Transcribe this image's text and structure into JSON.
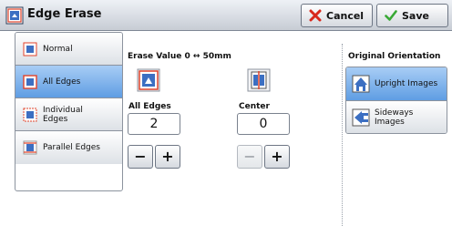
{
  "window": {
    "title": "Edge Erase",
    "cancel_label": "Cancel",
    "save_label": "Save"
  },
  "erase_mode": {
    "options": [
      {
        "label": "Normal",
        "selected": false
      },
      {
        "label": "All Edges",
        "selected": true
      },
      {
        "label": "Individual Edges",
        "selected": false
      },
      {
        "label": "Parallel Edges",
        "selected": false
      }
    ]
  },
  "erase_value": {
    "range_label": "Erase Value 0 ↔ 50mm",
    "all_edges": {
      "label": "All Edges",
      "value": "2"
    },
    "center": {
      "label": "Center",
      "value": "0"
    },
    "minus_label": "−",
    "plus_label": "+"
  },
  "orientation": {
    "label": "Original Orientation",
    "options": [
      {
        "label": "Upright Images",
        "selected": true
      },
      {
        "label": "Sideways Images",
        "selected": false
      }
    ]
  },
  "colors": {
    "selected": "#5f9de3",
    "cancel_icon": "#d8281c",
    "save_icon": "#39a935",
    "edge_marker": "#e0432b"
  }
}
